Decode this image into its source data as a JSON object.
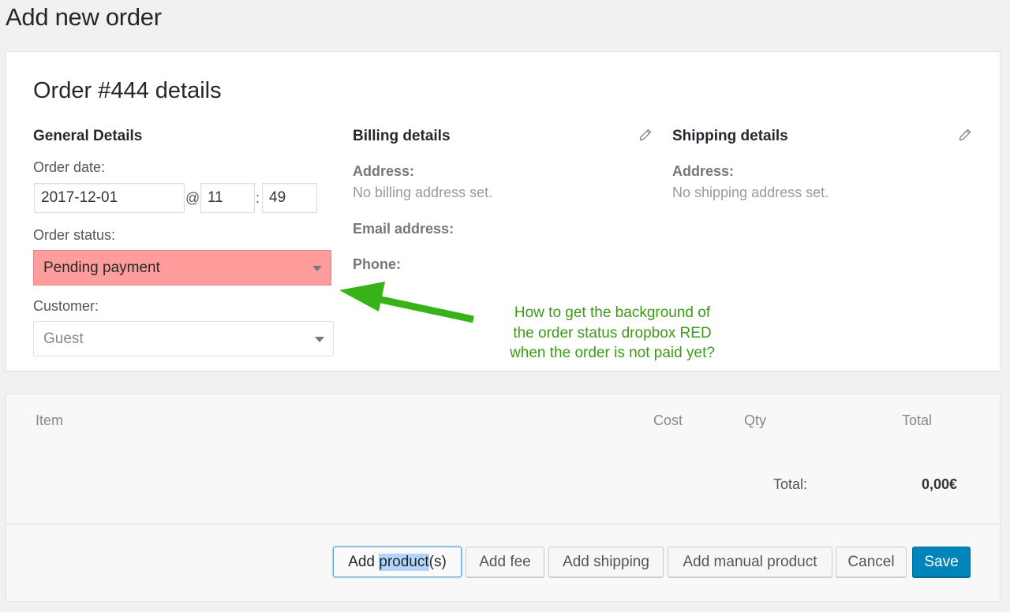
{
  "page": {
    "title": "Add new order"
  },
  "order": {
    "heading": "Order #444 details",
    "general": {
      "heading": "General Details",
      "date_label": "Order date:",
      "date_value": "2017-12-01",
      "at_sep": "@",
      "hour_value": "11",
      "colon_sep": ":",
      "minute_value": "49",
      "status_label": "Order status:",
      "status_value": "Pending payment",
      "status_bg": "#ff9c9c",
      "customer_label": "Customer:",
      "customer_value": "Guest"
    },
    "billing": {
      "heading": "Billing details",
      "address_label": "Address:",
      "address_value": "No billing address set.",
      "email_label": "Email address:",
      "phone_label": "Phone:",
      "edit_icon": "pencil-icon"
    },
    "shipping": {
      "heading": "Shipping details",
      "address_label": "Address:",
      "address_value": "No shipping address set.",
      "edit_icon": "pencil-icon"
    }
  },
  "annotation": {
    "lines": [
      "How to get the background of",
      "the order status dropbox RED",
      "when the order is not paid yet?"
    ],
    "color": "#3d9a17"
  },
  "items": {
    "columns": [
      "Item",
      "Cost",
      "Qty",
      "Total"
    ],
    "total_label": "Total:",
    "total_value": "0,00€"
  },
  "buttons": {
    "add_product_prefix": "Add ",
    "add_product_highlight": "product",
    "add_product_suffix": "(s)",
    "add_fee": "Add fee",
    "add_shipping": "Add shipping",
    "add_manual_product": "Add manual product",
    "cancel": "Cancel",
    "save": "Save"
  }
}
